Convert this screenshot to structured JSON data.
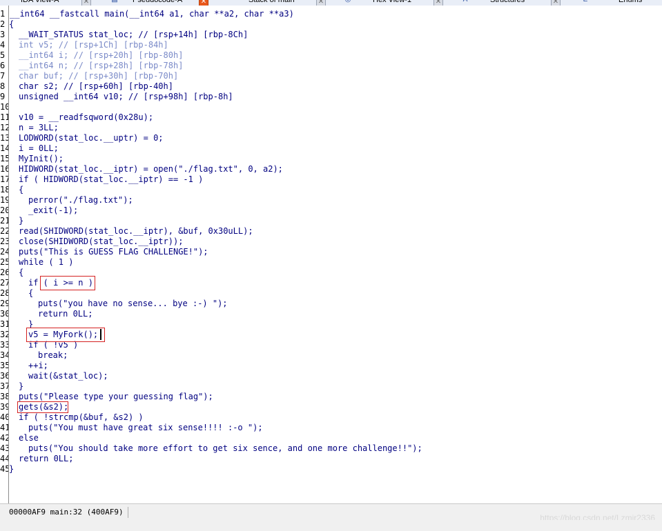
{
  "tabs": [
    {
      "label": "IDA View-A",
      "active": false
    },
    {
      "label": "Pseudocode-A",
      "active": true
    },
    {
      "label": "Stack of main",
      "active": false
    },
    {
      "label": "Hex View-1",
      "active": false
    },
    {
      "label": "Structures",
      "active": false
    },
    {
      "label": "Enums",
      "active": false
    }
  ],
  "code": {
    "line_numbers": [
      "1",
      "2",
      "3",
      "4",
      "5",
      "6",
      "7",
      "8",
      "9",
      "10",
      "11",
      "12",
      "13",
      "14",
      "15",
      "16",
      "17",
      "18",
      "19",
      "20",
      "21",
      "22",
      "23",
      "24",
      "25",
      "26",
      "27",
      "28",
      "29",
      "30",
      "31",
      "32",
      "33",
      "34",
      "35",
      "36",
      "37",
      "38",
      "39",
      "40",
      "41",
      "42",
      "43",
      "44",
      "45"
    ],
    "signature": "__int64 __fastcall main(__int64 a1, char **a2, char **a3)",
    "open_brace": "{",
    "close_brace": "}",
    "l3": "__WAIT_STATUS stat_loc; // [rsp+14h] [rbp-8Ch]",
    "l4": "int v5; // [rsp+1Ch] [rbp-84h]",
    "l5": "__int64 i; // [rsp+20h] [rbp-80h]",
    "l6": "__int64 n; // [rsp+28h] [rbp-78h]",
    "l7": "char buf; // [rsp+30h] [rbp-70h]",
    "l8": "char s2; // [rsp+60h] [rbp-40h]",
    "l9": "unsigned __int64 v10; // [rsp+98h] [rbp-8h]",
    "l11": "v10 = __readfsqword(0x28u);",
    "l12": "n = 3LL;",
    "l13": "LODWORD(stat_loc.__uptr) = 0;",
    "l14": "i = 0LL;",
    "l15": "MyInit();",
    "l16": "HIDWORD(stat_loc.__iptr) = open(\"./flag.txt\", 0, a2);",
    "l17": "if ( HIDWORD(stat_loc.__iptr) == -1 )",
    "l18": "{",
    "l19": "perror(\"./flag.txt\");",
    "l20": "_exit(-1);",
    "l21": "}",
    "l22": "read(SHIDWORD(stat_loc.__iptr), &buf, 0x30uLL);",
    "l23": "close(SHIDWORD(stat_loc.__iptr));",
    "l24": "puts(\"This is GUESS FLAG CHALLENGE!\");",
    "l25": "while ( 1 )",
    "l26": "{",
    "l27": "if ( i >= n )",
    "l28": "{",
    "l29": "puts(\"you have no sense... bye :-) \");",
    "l30": "return 0LL;",
    "l31": "}",
    "l32": "v5 = MyFork();",
    "l33": "if ( !v5 )",
    "l34": "break;",
    "l35": "++i;",
    "l36": "wait(&stat_loc);",
    "l37": "}",
    "l38": "puts(\"Please type your guessing flag\");",
    "l39": "gets(&s2);",
    "l40": "if ( !strcmp(&buf, &s2) )",
    "l41": "puts(\"You must have great six sense!!!! :-o \");",
    "l42": "else",
    "l43": "puts(\"You should take more effort to get six sence, and one more challenge!!\");",
    "l44": "return 0LL;"
  },
  "status": {
    "address_text": "00000AF9 main:32 (400AF9)"
  },
  "watermark": "https://blog.csdn.net/Lzmir2336",
  "colors": {
    "keyword": "#000080",
    "variable": "#4a5fd4",
    "comment": "#7a8ac8",
    "highlight_box": "#d42020",
    "active_tab_close": "#e8581c"
  }
}
